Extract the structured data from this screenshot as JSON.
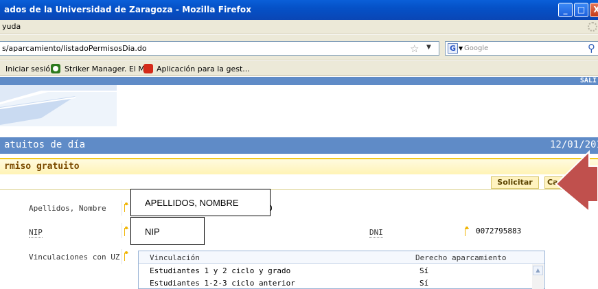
{
  "browser": {
    "title": "ados de la Universidad de Zaragoza - Mozilla Firefox",
    "menu": "yuda",
    "url": "s/aparcamiento/listadoPermisosDia.do",
    "search_engine_letter": "G",
    "search_placeholder": "Google",
    "window_buttons": {
      "minimize": "_",
      "maximize": "□",
      "close": "X"
    },
    "bookmarks": [
      "Iniciar sesión",
      "Striker Manager. El M...",
      "Aplicación para la gest..."
    ]
  },
  "page": {
    "top_link": "SALI",
    "section_title": "atuitos de día",
    "date": "12/01/201",
    "subsection_title": "rmiso gratuito",
    "buttons": {
      "solicitar": "Solicitar",
      "cancel": "Ca"
    },
    "form": {
      "apellidos_label": "Apellidos, Nombre",
      "apellidos_value_hint": "APELLIDOS, NOMBRE",
      "apellidos_value_tail": "O",
      "nip_label": "NIP",
      "nip_value_hint": "NIP",
      "dni_label": "DNI",
      "dni_value": "0072795883",
      "vinculaciones_label": "Vinculaciones con UZ"
    },
    "table": {
      "columns": [
        "Vinculación",
        "Derecho aparcamiento"
      ],
      "rows": [
        {
          "vinculacion": "Estudiantes 1 y 2 ciclo y grado",
          "derecho": "Sí"
        },
        {
          "vinculacion": "Estudiantes 1-2-3 ciclo anterior",
          "derecho": "Sí"
        }
      ]
    }
  },
  "colors": {
    "section_blue": "#5f8bc7",
    "yellow_accent": "#f2c91d",
    "arrow_red": "#c0504d"
  }
}
